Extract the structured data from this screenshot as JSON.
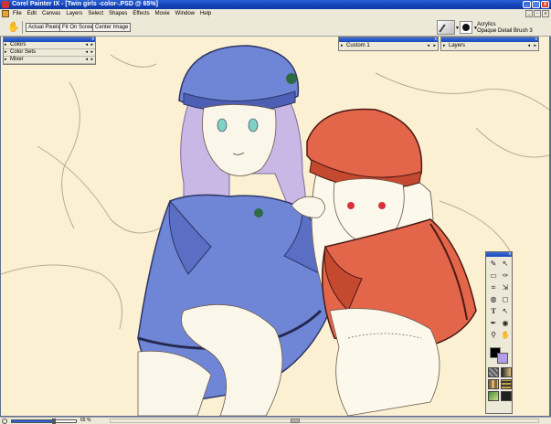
{
  "window": {
    "title": "Corel Painter IX - [Twin girls -color-.PSD @ 65%]"
  },
  "menu": [
    "File",
    "Edit",
    "Canvas",
    "Layers",
    "Select",
    "Shapes",
    "Effects",
    "Movie",
    "Window",
    "Help"
  ],
  "property_bar": {
    "buttons": [
      "Actual Pixels",
      "Fit On Screen",
      "Center Image"
    ],
    "brush_category": "Acrylics",
    "brush_variant": "Opaque Detail Brush 3"
  },
  "palettes": {
    "left": {
      "rows": [
        "Colors",
        "Color Sets",
        "Mixer"
      ]
    },
    "custom": {
      "label": "Custom 1"
    },
    "layers": {
      "label": "Layers"
    }
  },
  "toolbox": {
    "tools": [
      "brush-icon",
      "dropper-icon",
      "rect-select-icon",
      "lasso-icon",
      "crop-icon",
      "layer-adjuster-icon",
      "paint-bucket-icon",
      "eraser-icon",
      "text-icon",
      "shape-selection-icon",
      "pen-icon",
      "warp-icon",
      "magnifier-icon",
      "grabber-icon"
    ],
    "main_color": "#000000",
    "additional_color": "#b49de6"
  },
  "status": {
    "zoom_text": "65 %",
    "zoom_level": 0.65
  },
  "colors": {
    "accent": "#2a5fd6",
    "canvas": "#fbf1d2",
    "blue_girl": "#6f86d6",
    "red_girl": "#e3664a"
  }
}
